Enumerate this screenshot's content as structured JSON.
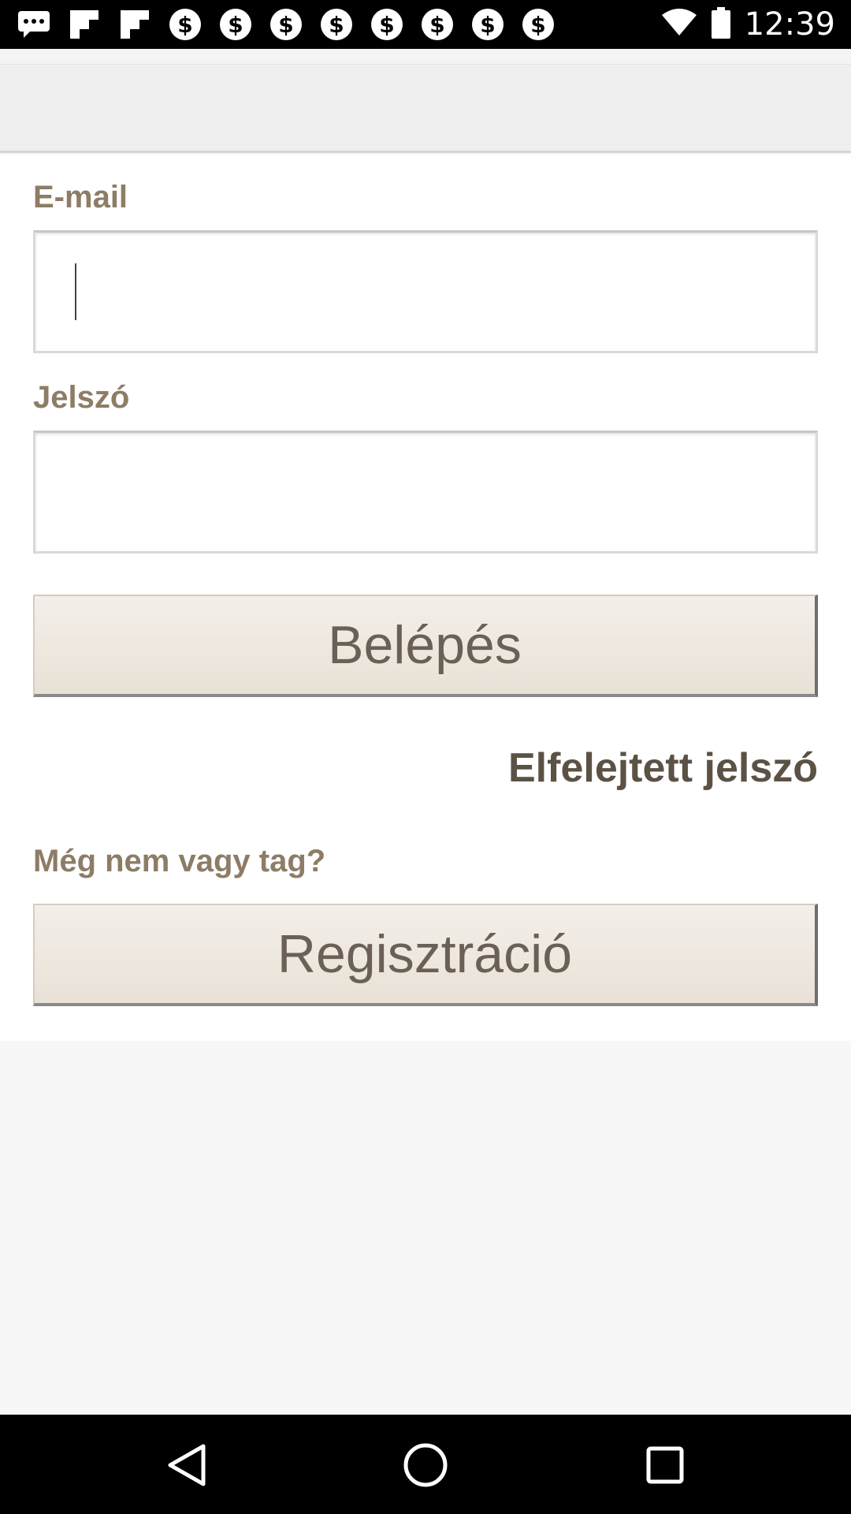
{
  "status_bar": {
    "time": "12:39",
    "icons": [
      "message-icon",
      "flipboard-icon",
      "flipboard-icon",
      "dollar-coin-icon",
      "dollar-coin-icon",
      "dollar-coin-icon",
      "dollar-coin-icon",
      "dollar-coin-icon",
      "dollar-coin-icon",
      "dollar-coin-icon",
      "dollar-coin-icon",
      "wifi-icon",
      "battery-icon"
    ]
  },
  "login_form": {
    "email_label": "E-mail",
    "email_value": "",
    "password_label": "Jelszó",
    "password_value": "",
    "login_button": "Belépés",
    "forgot_password_link": "Elfelejtett jelszó",
    "not_member_text": "Még nem vagy tag?",
    "register_button": "Regisztráció"
  },
  "nav_bar": {
    "buttons": [
      "back-icon",
      "home-icon",
      "recents-icon"
    ]
  },
  "colors": {
    "label": "#8d7d66",
    "button_bg": "#ece5db",
    "button_text": "#6b6055",
    "link": "#5b5245"
  }
}
